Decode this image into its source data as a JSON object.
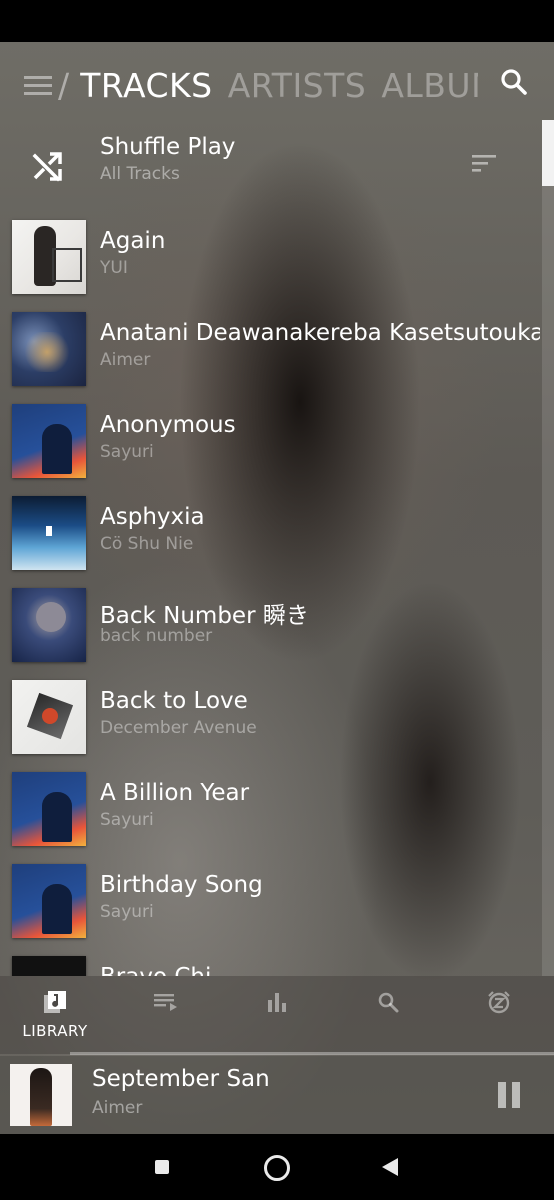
{
  "header": {
    "tabs": [
      "TRACKS",
      "ARTISTS",
      "ALBUMS"
    ],
    "active_tab": "TRACKS",
    "menu_icon": "hamburger-menu-icon",
    "search_icon": "search-icon"
  },
  "shuffle": {
    "title": "Shuffle Play",
    "subtitle": "All Tracks",
    "icon": "shuffle-icon",
    "sort_icon": "sort-icon"
  },
  "tracks": [
    {
      "title": "Again",
      "artist": "YUI"
    },
    {
      "title": "Anatani Deawanakereba Kasetsutouka",
      "artist": "Aimer"
    },
    {
      "title": "Anonymous",
      "artist": "Sayuri"
    },
    {
      "title": "Asphyxia",
      "artist": "Cö Shu Nie"
    },
    {
      "title": "Back Number 瞬き",
      "artist": "back number"
    },
    {
      "title": "Back to Love",
      "artist": "December Avenue"
    },
    {
      "title": "A Billion Year",
      "artist": "Sayuri"
    },
    {
      "title": "Birthday Song",
      "artist": "Sayuri"
    },
    {
      "title": "Bravo Chi...",
      "artist": ""
    }
  ],
  "bottom_nav": {
    "items": [
      {
        "icon": "library-icon",
        "label": "LIBRARY",
        "active": true
      },
      {
        "icon": "queue-icon",
        "label": ""
      },
      {
        "icon": "equalizer-icon",
        "label": ""
      },
      {
        "icon": "search-icon",
        "label": ""
      },
      {
        "icon": "sleep-timer-icon",
        "label": ""
      }
    ]
  },
  "now_playing": {
    "title": "September San",
    "artist": "Aimer",
    "progress": 0.0,
    "control_icon": "pause-icon"
  },
  "colors": {
    "accent": "#ffffff",
    "muted_text": "#a7a59f",
    "overlay": "#5f5d58"
  }
}
